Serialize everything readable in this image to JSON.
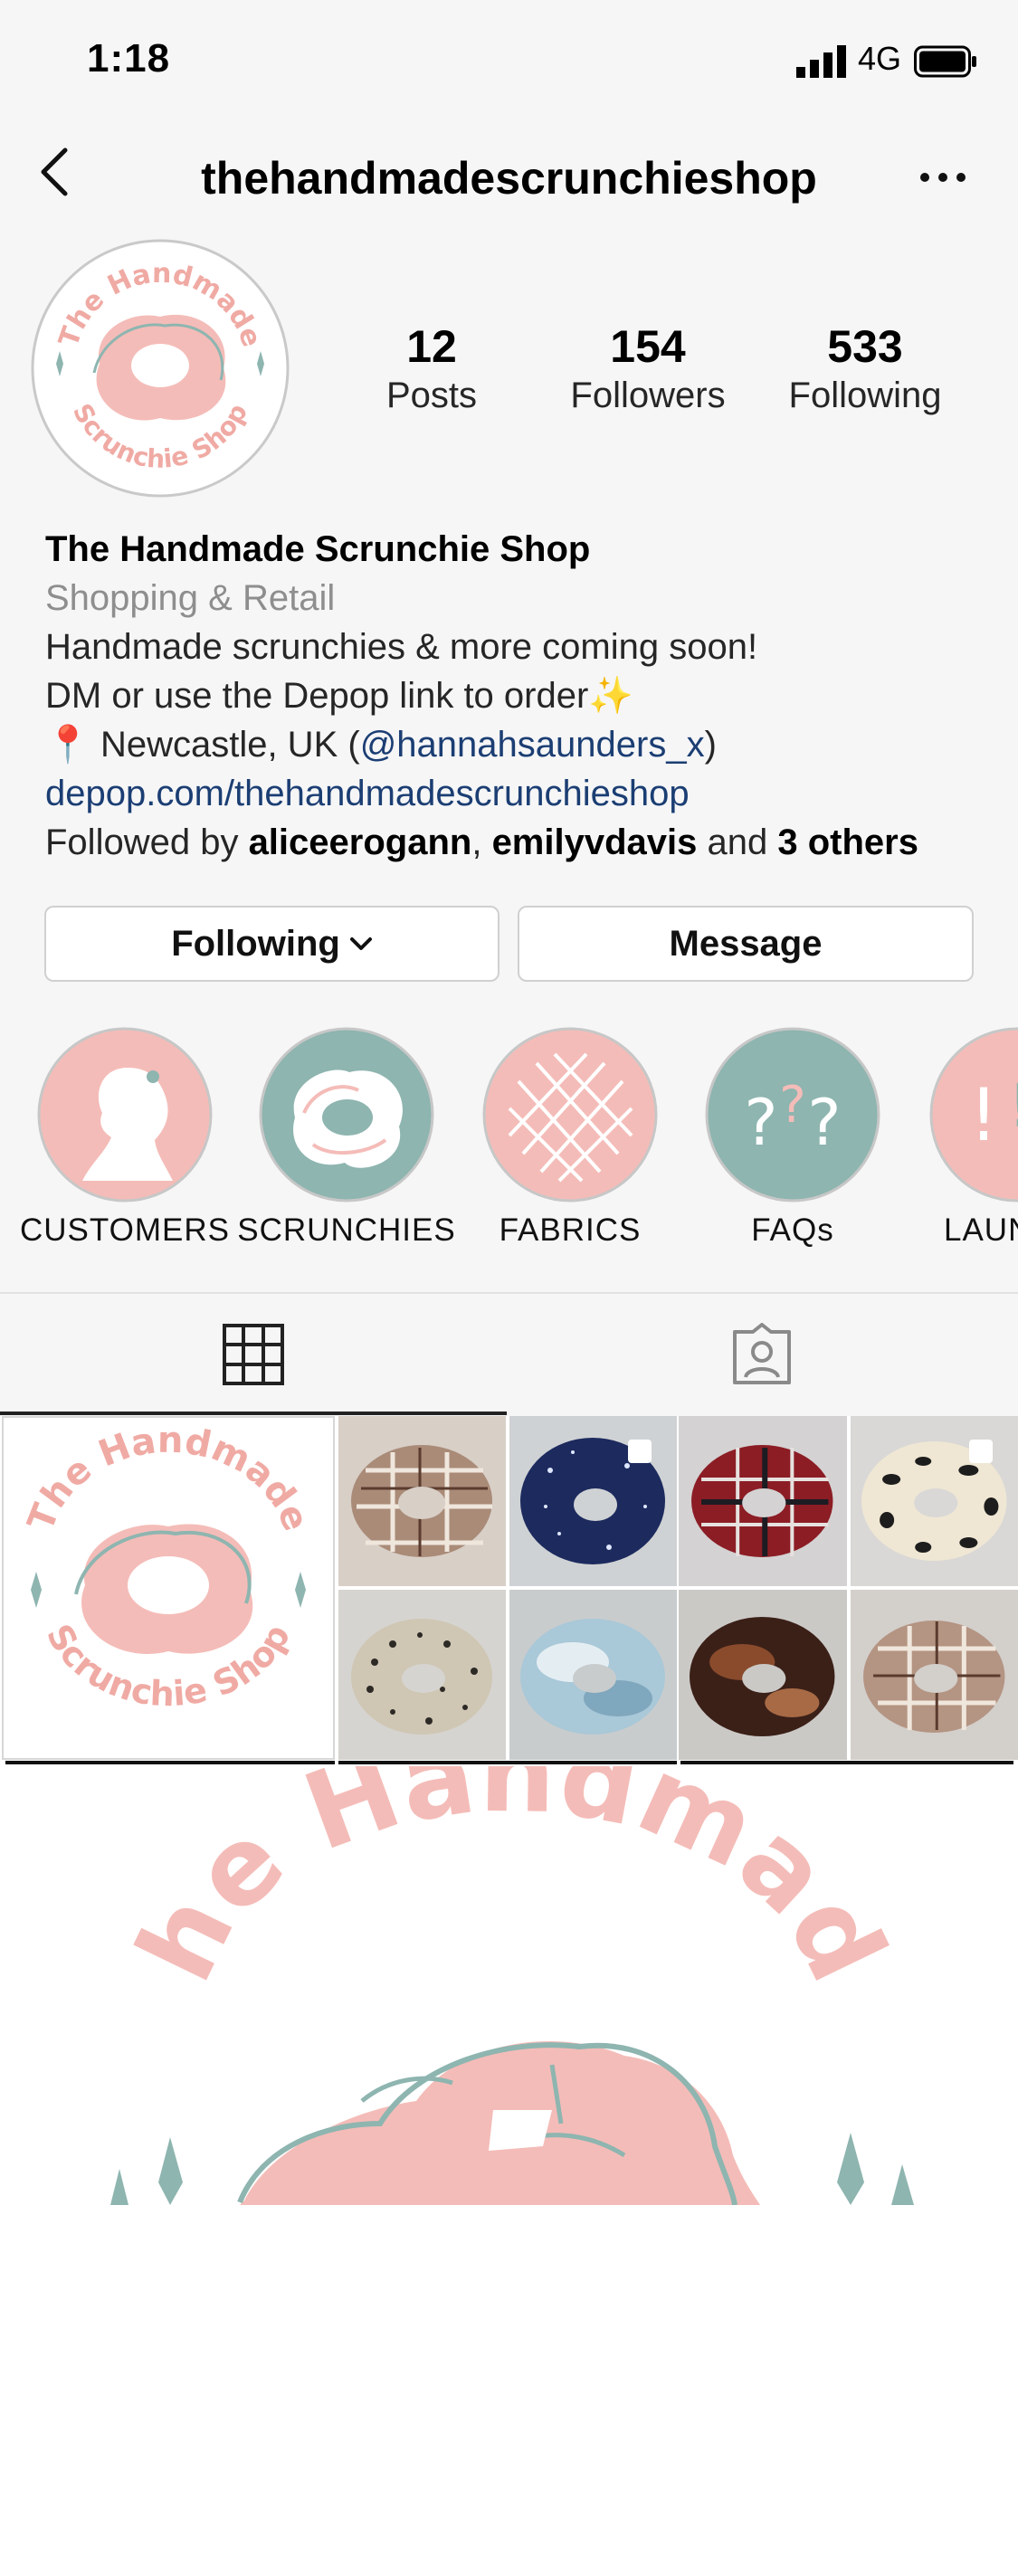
{
  "status_bar": {
    "time": "1:18",
    "network": "4G"
  },
  "header": {
    "username": "thehandmadescrunchieshop"
  },
  "profile": {
    "stats": [
      {
        "num": "12",
        "label": "Posts"
      },
      {
        "num": "154",
        "label": "Followers"
      },
      {
        "num": "533",
        "label": "Following"
      }
    ],
    "name": "The Handmade Scrunchie Shop",
    "category": "Shopping & Retail",
    "bio_line1": "Handmade scrunchies & more coming soon!",
    "bio_line2": "DM or use the Depop link to order",
    "bio_line2_emoji": "✨",
    "location_pin": "📍",
    "location_text": "Newcastle, UK (",
    "location_mention": "@hannahsaunders_x",
    "location_close": ")",
    "website": "depop.com/thehandmadescrunchieshop",
    "followed_by_prefix": "Followed by ",
    "followed_by_user1": "aliceerogann",
    "followed_by_sep": ", ",
    "followed_by_user2": "emilyvdavis",
    "followed_by_and": " and ",
    "followed_by_others": "3 others"
  },
  "buttons": {
    "following": "Following",
    "message": "Message"
  },
  "highlights": [
    {
      "label": "CUSTOMERS"
    },
    {
      "label": "SCRUNCHIES"
    },
    {
      "label": "FABRICS"
    },
    {
      "label": "FAQs"
    },
    {
      "label": "LAUNCH"
    }
  ],
  "logo_text": {
    "top": "The Handmade",
    "bottom": "Scrunchie Shop"
  },
  "colors": {
    "brand_pink": "#f4bcb8",
    "brand_teal": "#8eb5b0",
    "link": "#1b3e73"
  },
  "icons": [
    "back-arrow-icon",
    "more-icon",
    "grid-icon",
    "tagged-icon",
    "chevron-down-icon",
    "multi-post-icon"
  ]
}
